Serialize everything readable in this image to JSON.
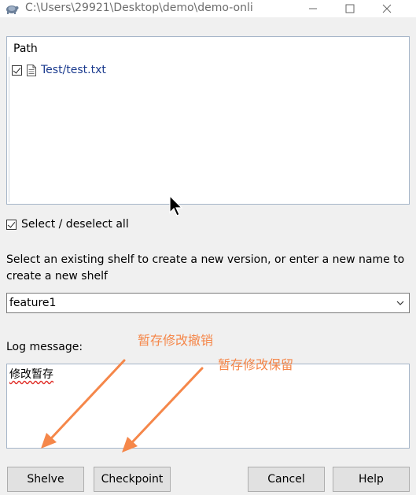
{
  "window": {
    "title": "C:\\Users\\29921\\Desktop\\demo\\demo-onli"
  },
  "path_list": {
    "header": "Path",
    "items": [
      {
        "name": "Test/test.txt",
        "checked": true
      }
    ]
  },
  "select_all": {
    "label": "Select / deselect all",
    "checked": true
  },
  "shelf": {
    "description": "Select an existing shelf to create a new version, or enter a new name to create a new shelf",
    "selected": "feature1"
  },
  "log": {
    "label": "Log message:",
    "value": "修改暂存"
  },
  "annotations": {
    "a1": "暂存修改撤销",
    "a2": "暂存修改保留",
    "color": "#f5874a"
  },
  "buttons": {
    "shelve": "Shelve",
    "checkpoint": "Checkpoint",
    "cancel": "Cancel",
    "help": "Help"
  }
}
